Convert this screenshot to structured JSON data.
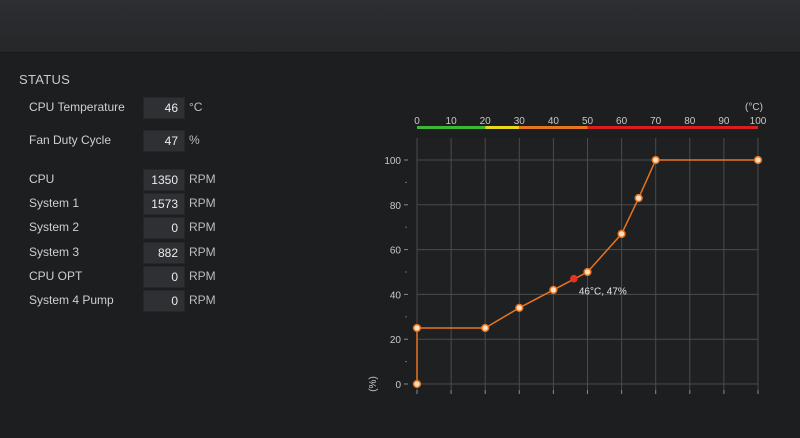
{
  "status": {
    "title": "STATUS",
    "cpu_temperature": {
      "label": "CPU Temperature",
      "value": "46",
      "unit": "°C"
    },
    "fan_duty_cycle": {
      "label": "Fan Duty Cycle",
      "value": "47",
      "unit": "%"
    },
    "fans": [
      {
        "label": "CPU",
        "value": "1350",
        "unit": "RPM"
      },
      {
        "label": "System 1",
        "value": "1573",
        "unit": "RPM"
      },
      {
        "label": "System 2",
        "value": "0",
        "unit": "RPM"
      },
      {
        "label": "System 3",
        "value": "882",
        "unit": "RPM"
      },
      {
        "label": "CPU OPT",
        "value": "0",
        "unit": "RPM"
      },
      {
        "label": "System 4 Pump",
        "value": "0",
        "unit": "RPM"
      }
    ]
  },
  "colors": {
    "curve": "#e8741e",
    "current_point": "#e8321e",
    "scale_green": "#3cb832",
    "scale_yellow": "#e8d81e",
    "scale_orange": "#e8741e",
    "scale_red": "#d81e1e"
  },
  "chart_data": {
    "type": "line",
    "x_unit_label": "(°C)",
    "y_unit_label": "(%)",
    "x_ticks": [
      "0",
      "10",
      "20",
      "30",
      "40",
      "50",
      "60",
      "70",
      "80",
      "90",
      "100"
    ],
    "y_ticks": [
      "0",
      "20",
      "40",
      "60",
      "80",
      "100"
    ],
    "xlim": [
      0,
      100
    ],
    "ylim": [
      0,
      100
    ],
    "grid": true,
    "series": [
      {
        "x": [
          0,
          0,
          20,
          30,
          40,
          50,
          60,
          65,
          70,
          100
        ],
        "y": [
          0,
          25,
          25,
          34,
          42,
          50,
          67,
          83,
          100,
          100
        ]
      }
    ],
    "current": {
      "x": 46,
      "y": 47,
      "label": "46°C, 47%"
    }
  }
}
